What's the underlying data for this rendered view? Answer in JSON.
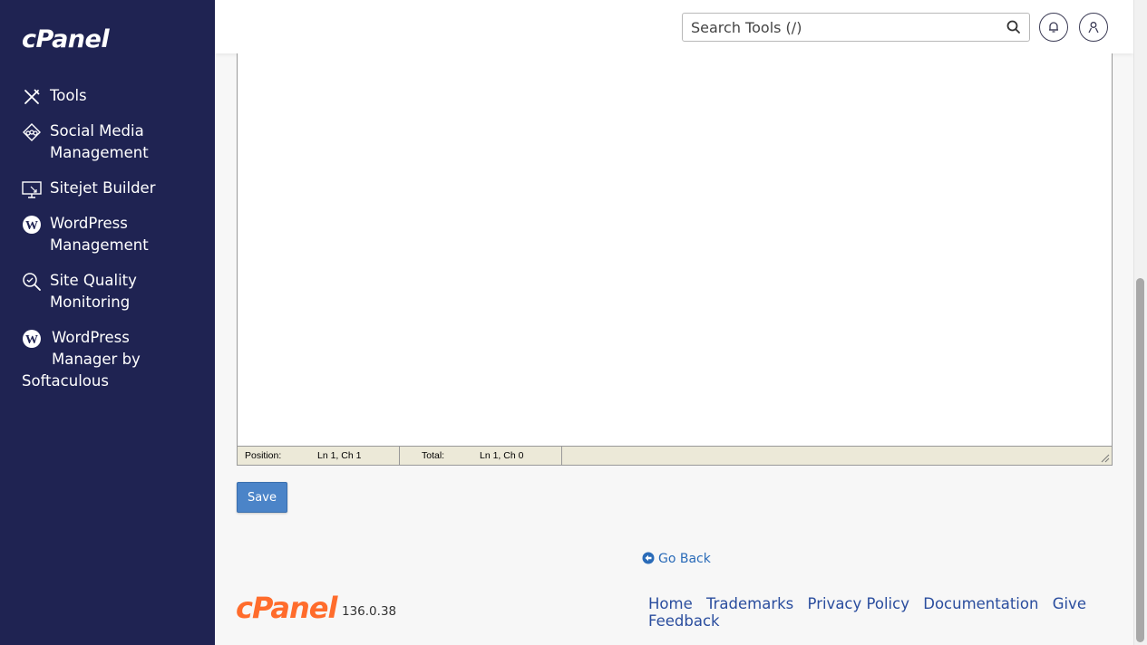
{
  "sidebar": {
    "logo": "cPanel",
    "items": [
      {
        "label": "Tools",
        "icon": "tools-icon"
      },
      {
        "label": "Social Media Management",
        "line1": "Social Media",
        "line2": "Management",
        "icon": "social-media-icon"
      },
      {
        "label": "Sitejet Builder",
        "icon": "sitejet-icon"
      },
      {
        "label": "WordPress Management",
        "line1": "WordPress",
        "line2": "Management",
        "icon": "wordpress-icon"
      },
      {
        "label": "Site Quality Monitoring",
        "line1": "Site Quality",
        "line2": "Monitoring",
        "icon": "site-quality-icon"
      },
      {
        "label": "WordPress Manager by Softaculous",
        "line1": "WordPress",
        "line2": "Manager by",
        "line3": "Softaculous",
        "icon": "wordpress-icon"
      }
    ]
  },
  "topbar": {
    "search_placeholder": "Search Tools (/)"
  },
  "editor": {
    "position_label": "Position:",
    "position_value": "Ln 1, Ch 1",
    "total_label": "Total:",
    "total_value": "Ln 1, Ch 0"
  },
  "actions": {
    "save_label": "Save",
    "go_back_label": "Go Back"
  },
  "footer": {
    "logo": "cPanel",
    "version": "136.0.38",
    "links": [
      "Home",
      "Trademarks",
      "Privacy Policy",
      "Documentation",
      "Give Feedback"
    ]
  },
  "colors": {
    "sidebar_bg": "#1f2352",
    "accent_blue": "#4b84c8",
    "link_blue": "#2a4d9e",
    "brand_orange": "#ff6c2c"
  }
}
